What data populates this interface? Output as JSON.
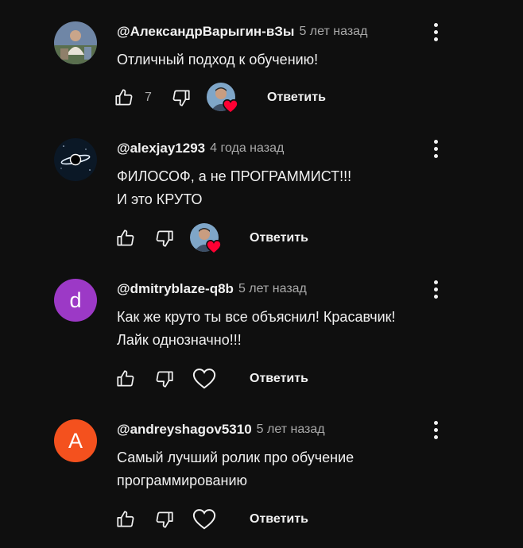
{
  "colors": {
    "background": "#0f0f0f",
    "text_primary": "#f1f1f1",
    "text_secondary": "#aaaaaa",
    "heart_red": "#ff0033",
    "avatar_purple": "#9c39c6",
    "avatar_orange": "#f4511e"
  },
  "comments": [
    {
      "avatar": "photo-avatar",
      "author": "@АлександрВарыгин-вЗы",
      "time": "5 лет назад",
      "lines": [
        "Отличный подход к обучению!"
      ],
      "likes": "7",
      "creator_hearted": true,
      "reply_label": "Ответить"
    },
    {
      "avatar": "galaxy-avatar",
      "author": "@alexjay1293",
      "time": "4 года назад",
      "lines": [
        "ФИЛОСОФ, а не ПРОГРАММИСТ!!!",
        "И это КРУТО"
      ],
      "likes": "",
      "creator_hearted": true,
      "reply_label": "Ответить"
    },
    {
      "avatar_letter": "d",
      "avatar_color": "#9c39c6",
      "author": "@dmitryblaze-q8b",
      "time": "5 лет назад",
      "lines": [
        "Как же круто ты все объяснил! Красавчик!",
        "Лайк однозначно!!!"
      ],
      "likes": "",
      "creator_hearted": false,
      "reply_label": "Ответить"
    },
    {
      "avatar_letter": "A",
      "avatar_color": "#f4511e",
      "author": "@andreyshagov5310",
      "time": "5 лет назад",
      "lines": [
        "Самый лучший ролик про обучение",
        "программированию"
      ],
      "likes": "",
      "creator_hearted": false,
      "reply_label": "Ответить"
    }
  ]
}
